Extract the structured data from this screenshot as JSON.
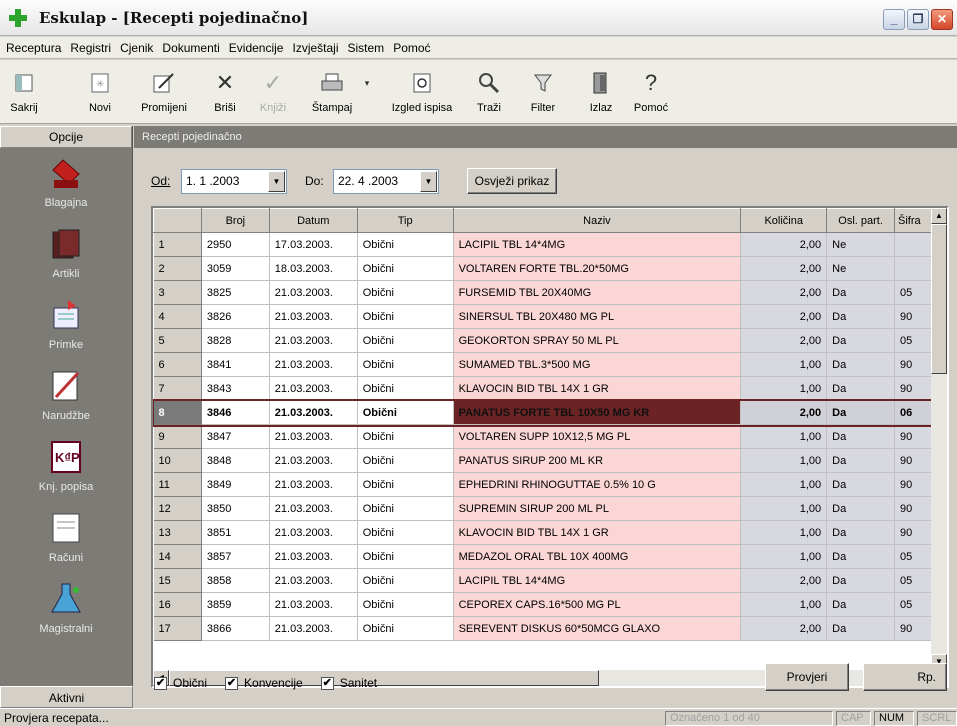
{
  "window": {
    "title": "Eskulap - [Recepti pojedinačno]",
    "min": "_",
    "max": "❐",
    "close": "✕"
  },
  "menu": [
    "Receptura",
    "Registri",
    "Cjenik",
    "Dokumenti",
    "Evidencije",
    "Izvještaji",
    "Sistem",
    "Pomoć"
  ],
  "toolbar": {
    "sakrij": "Sakrij",
    "novi": "Novi",
    "promijeni": "Promijeni",
    "brisi": "Briši",
    "knjizi": "Knjiži",
    "stampaj": "Štampaj",
    "izgled": "Izgled ispisa",
    "trazi": "Traži",
    "filter": "Filter",
    "izlaz": "Izlaz",
    "pomoc": "Pomoć"
  },
  "sidebar": {
    "header": "Opcije",
    "items": [
      "Blagajna",
      "Artikli",
      "Primke",
      "Narudžbe",
      "Knj. popisa",
      "Računi",
      "Magistralni"
    ],
    "footer": "Aktivni"
  },
  "panel": {
    "title": "Recepti pojedinačno"
  },
  "filter": {
    "od_label": "Od:",
    "od_value": "1. 1 .2003",
    "do_label": "Do:",
    "do_value": "22. 4 .2003",
    "refresh": "Osvježi prikaz"
  },
  "grid": {
    "columns": [
      "",
      "Broj",
      "Datum",
      "Tip",
      "Naziv",
      "Količina",
      "Osl. part.",
      "Šifra"
    ],
    "rows": [
      [
        "1",
        "2950",
        "17.03.2003.",
        "Obični",
        "LACIPIL TBL 14*4MG",
        "2,00",
        "Ne",
        ""
      ],
      [
        "2",
        "3059",
        "18.03.2003.",
        "Obični",
        "VOLTAREN FORTE TBL.20*50MG",
        "2,00",
        "Ne",
        ""
      ],
      [
        "3",
        "3825",
        "21.03.2003.",
        "Obični",
        "FURSEMID TBL 20X40MG",
        "2,00",
        "Da",
        "05"
      ],
      [
        "4",
        "3826",
        "21.03.2003.",
        "Obični",
        "SINERSUL TBL 20X480 MG PL",
        "2,00",
        "Da",
        "90"
      ],
      [
        "5",
        "3828",
        "21.03.2003.",
        "Obični",
        "GEOKORTON SPRAY  50 ML PL",
        "2,00",
        "Da",
        "05"
      ],
      [
        "6",
        "3841",
        "21.03.2003.",
        "Obični",
        "SUMAMED TBL.3*500 MG",
        "1,00",
        "Da",
        "90"
      ],
      [
        "7",
        "3843",
        "21.03.2003.",
        "Obični",
        "KLAVOCIN BID TBL 14X 1 GR",
        "1,00",
        "Da",
        "90"
      ],
      [
        "8",
        "3846",
        "21.03.2003.",
        "Obični",
        "PANATUS FORTE TBL 10X50 MG KR",
        "2,00",
        "Da",
        "06"
      ],
      [
        "9",
        "3847",
        "21.03.2003.",
        "Obični",
        "VOLTAREN SUPP 10X12,5 MG PL",
        "1,00",
        "Da",
        "90"
      ],
      [
        "10",
        "3848",
        "21.03.2003.",
        "Obični",
        "PANATUS SIRUP 200 ML KR",
        "1,00",
        "Da",
        "90"
      ],
      [
        "11",
        "3849",
        "21.03.2003.",
        "Obični",
        "EPHEDRINI RHINOGUTTAE 0.5% 10 G",
        "1,00",
        "Da",
        "90"
      ],
      [
        "12",
        "3850",
        "21.03.2003.",
        "Obični",
        "SUPREMIN SIRUP 200 ML PL",
        "1,00",
        "Da",
        "90"
      ],
      [
        "13",
        "3851",
        "21.03.2003.",
        "Obični",
        "KLAVOCIN BID TBL 14X 1 GR",
        "1,00",
        "Da",
        "90"
      ],
      [
        "14",
        "3857",
        "21.03.2003.",
        "Obični",
        "MEDAZOL ORAL TBL 10X 400MG",
        "1,00",
        "Da",
        "05"
      ],
      [
        "15",
        "3858",
        "21.03.2003.",
        "Obični",
        "LACIPIL TBL 14*4MG",
        "2,00",
        "Da",
        "05"
      ],
      [
        "16",
        "3859",
        "21.03.2003.",
        "Obični",
        "CEPOREX CAPS.16*500 MG PL",
        "1,00",
        "Da",
        "05"
      ],
      [
        "17",
        "3866",
        "21.03.2003.",
        "Obični",
        "SEREVENT DISKUS 60*50MCG GLAXO",
        "2,00",
        "Da",
        "90"
      ]
    ],
    "selected_row": 8
  },
  "options": {
    "obicni": "Obični",
    "konvencije": "Konvencije",
    "sanitet": "Sanitet",
    "check": "✔"
  },
  "buttons": {
    "provjeri": "Provjeri",
    "rp": "Rp."
  },
  "status": {
    "left": "Provjera recepata...",
    "count": "Označeno 1 od 40",
    "cap": "CAP",
    "num": "NUM",
    "scrl": "SCRL"
  },
  "colors": {
    "naziv_bg": "#fbd6d6",
    "selected_naziv": "#6b2323",
    "sidebar_bg": "#7d7b76"
  }
}
